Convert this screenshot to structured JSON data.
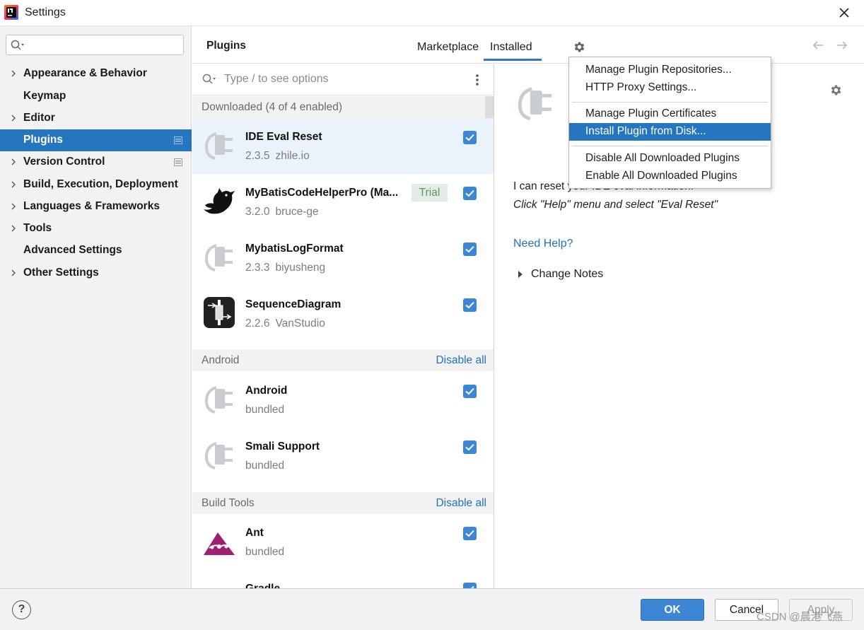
{
  "window": {
    "title": "Settings"
  },
  "sidebar": {
    "search_placeholder": "",
    "items": [
      {
        "label": "Appearance & Behavior",
        "expandable": true
      },
      {
        "label": "Keymap",
        "expandable": false
      },
      {
        "label": "Editor",
        "expandable": true
      },
      {
        "label": "Plugins",
        "expandable": false,
        "selected": true
      },
      {
        "label": "Version Control",
        "expandable": true
      },
      {
        "label": "Build, Execution, Deployment",
        "expandable": true
      },
      {
        "label": "Languages & Frameworks",
        "expandable": true
      },
      {
        "label": "Tools",
        "expandable": true
      },
      {
        "label": "Advanced Settings",
        "expandable": false
      },
      {
        "label": "Other Settings",
        "expandable": true
      }
    ]
  },
  "header": {
    "title": "Plugins",
    "tabs": [
      "Marketplace",
      "Installed"
    ],
    "active_tab": "Installed"
  },
  "list": {
    "search_placeholder": "Type / to see options",
    "groups": [
      {
        "label": "Downloaded (4 of 4 enabled)",
        "action": ""
      },
      {
        "label": "Android",
        "action": "Disable all"
      },
      {
        "label": "Build Tools",
        "action": "Disable all"
      }
    ],
    "plugins": [
      {
        "name": "IDE Eval Reset",
        "version": "2.3.5",
        "vendor": "zhile.io",
        "icon": "plug-icon",
        "enabled": true,
        "selected": true
      },
      {
        "name": "MyBatisCodeHelperPro (Ma...",
        "version": "3.2.0",
        "vendor": "bruce-ge",
        "icon": "bird-icon",
        "enabled": true,
        "badge": "Trial"
      },
      {
        "name": "MybatisLogFormat",
        "version": "2.3.3",
        "vendor": "biyusheng",
        "icon": "plug-icon",
        "enabled": true
      },
      {
        "name": "SequenceDiagram",
        "version": "2.2.6",
        "vendor": "VanStudio",
        "icon": "sequence-icon",
        "enabled": true
      },
      {
        "name": "Android",
        "version": "bundled",
        "vendor": "",
        "icon": "plug-icon",
        "enabled": true
      },
      {
        "name": "Smali Support",
        "version": "bundled",
        "vendor": "",
        "icon": "plug-icon",
        "enabled": true
      },
      {
        "name": "Ant",
        "version": "bundled",
        "vendor": "",
        "icon": "ant-icon",
        "enabled": true
      },
      {
        "name": "Gradle",
        "version": "",
        "vendor": "",
        "icon": "gradle-icon",
        "enabled": true
      }
    ]
  },
  "detail": {
    "description_line1": "I can reset your IDE eval information.",
    "description_line2": "Click \"Help\" menu and select \"Eval Reset\"",
    "help_link": "Need Help?",
    "change_notes": "Change Notes"
  },
  "menu": {
    "items": [
      "Manage Plugin Repositories...",
      "HTTP Proxy Settings...",
      "Manage Plugin Certificates",
      "Install Plugin from Disk...",
      "Disable All Downloaded Plugins",
      "Enable All Downloaded Plugins"
    ],
    "highlighted": "Install Plugin from Disk..."
  },
  "footer": {
    "help": "?",
    "ok": "OK",
    "cancel": "Cancel",
    "apply": "Apply"
  },
  "watermark": "CSDN @晨港飞燕",
  "colors": {
    "accent": "#2675bf",
    "link": "#2470c2",
    "checkbox": "#3d86d4"
  }
}
